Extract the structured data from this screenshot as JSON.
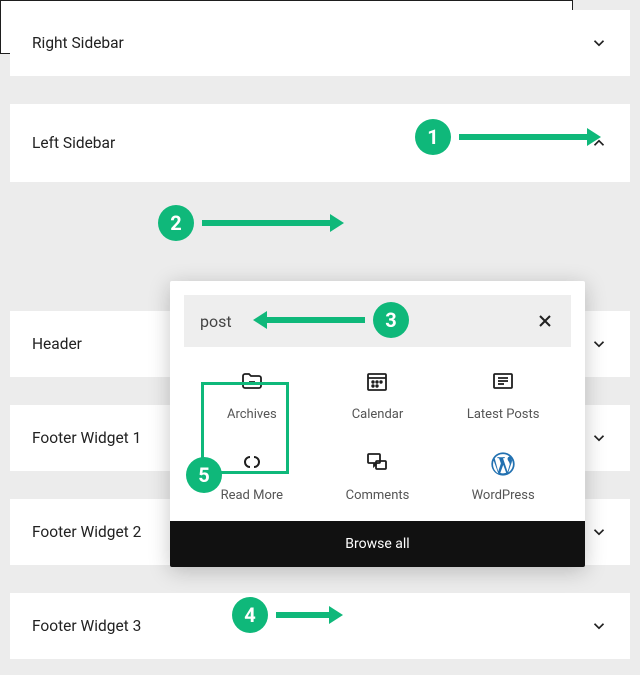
{
  "panels": {
    "right_sidebar": "Right Sidebar",
    "left_sidebar": "Left Sidebar",
    "header": "Header",
    "footer1": "Footer Widget 1",
    "footer2": "Footer Widget 2",
    "footer3": "Footer Widget 3"
  },
  "inserter": {
    "search_value": "post",
    "browse_all": "Browse all",
    "blocks": {
      "archives": "Archives",
      "calendar": "Calendar",
      "latest_posts": "Latest Posts",
      "read_more": "Read More",
      "comments": "Comments",
      "wordpress": "WordPress"
    }
  },
  "annotations": {
    "n1": "1",
    "n2": "2",
    "n3": "3",
    "n4": "4",
    "n5": "5"
  },
  "colors": {
    "accent": "#0fb87a",
    "plus": "#0073aa"
  }
}
